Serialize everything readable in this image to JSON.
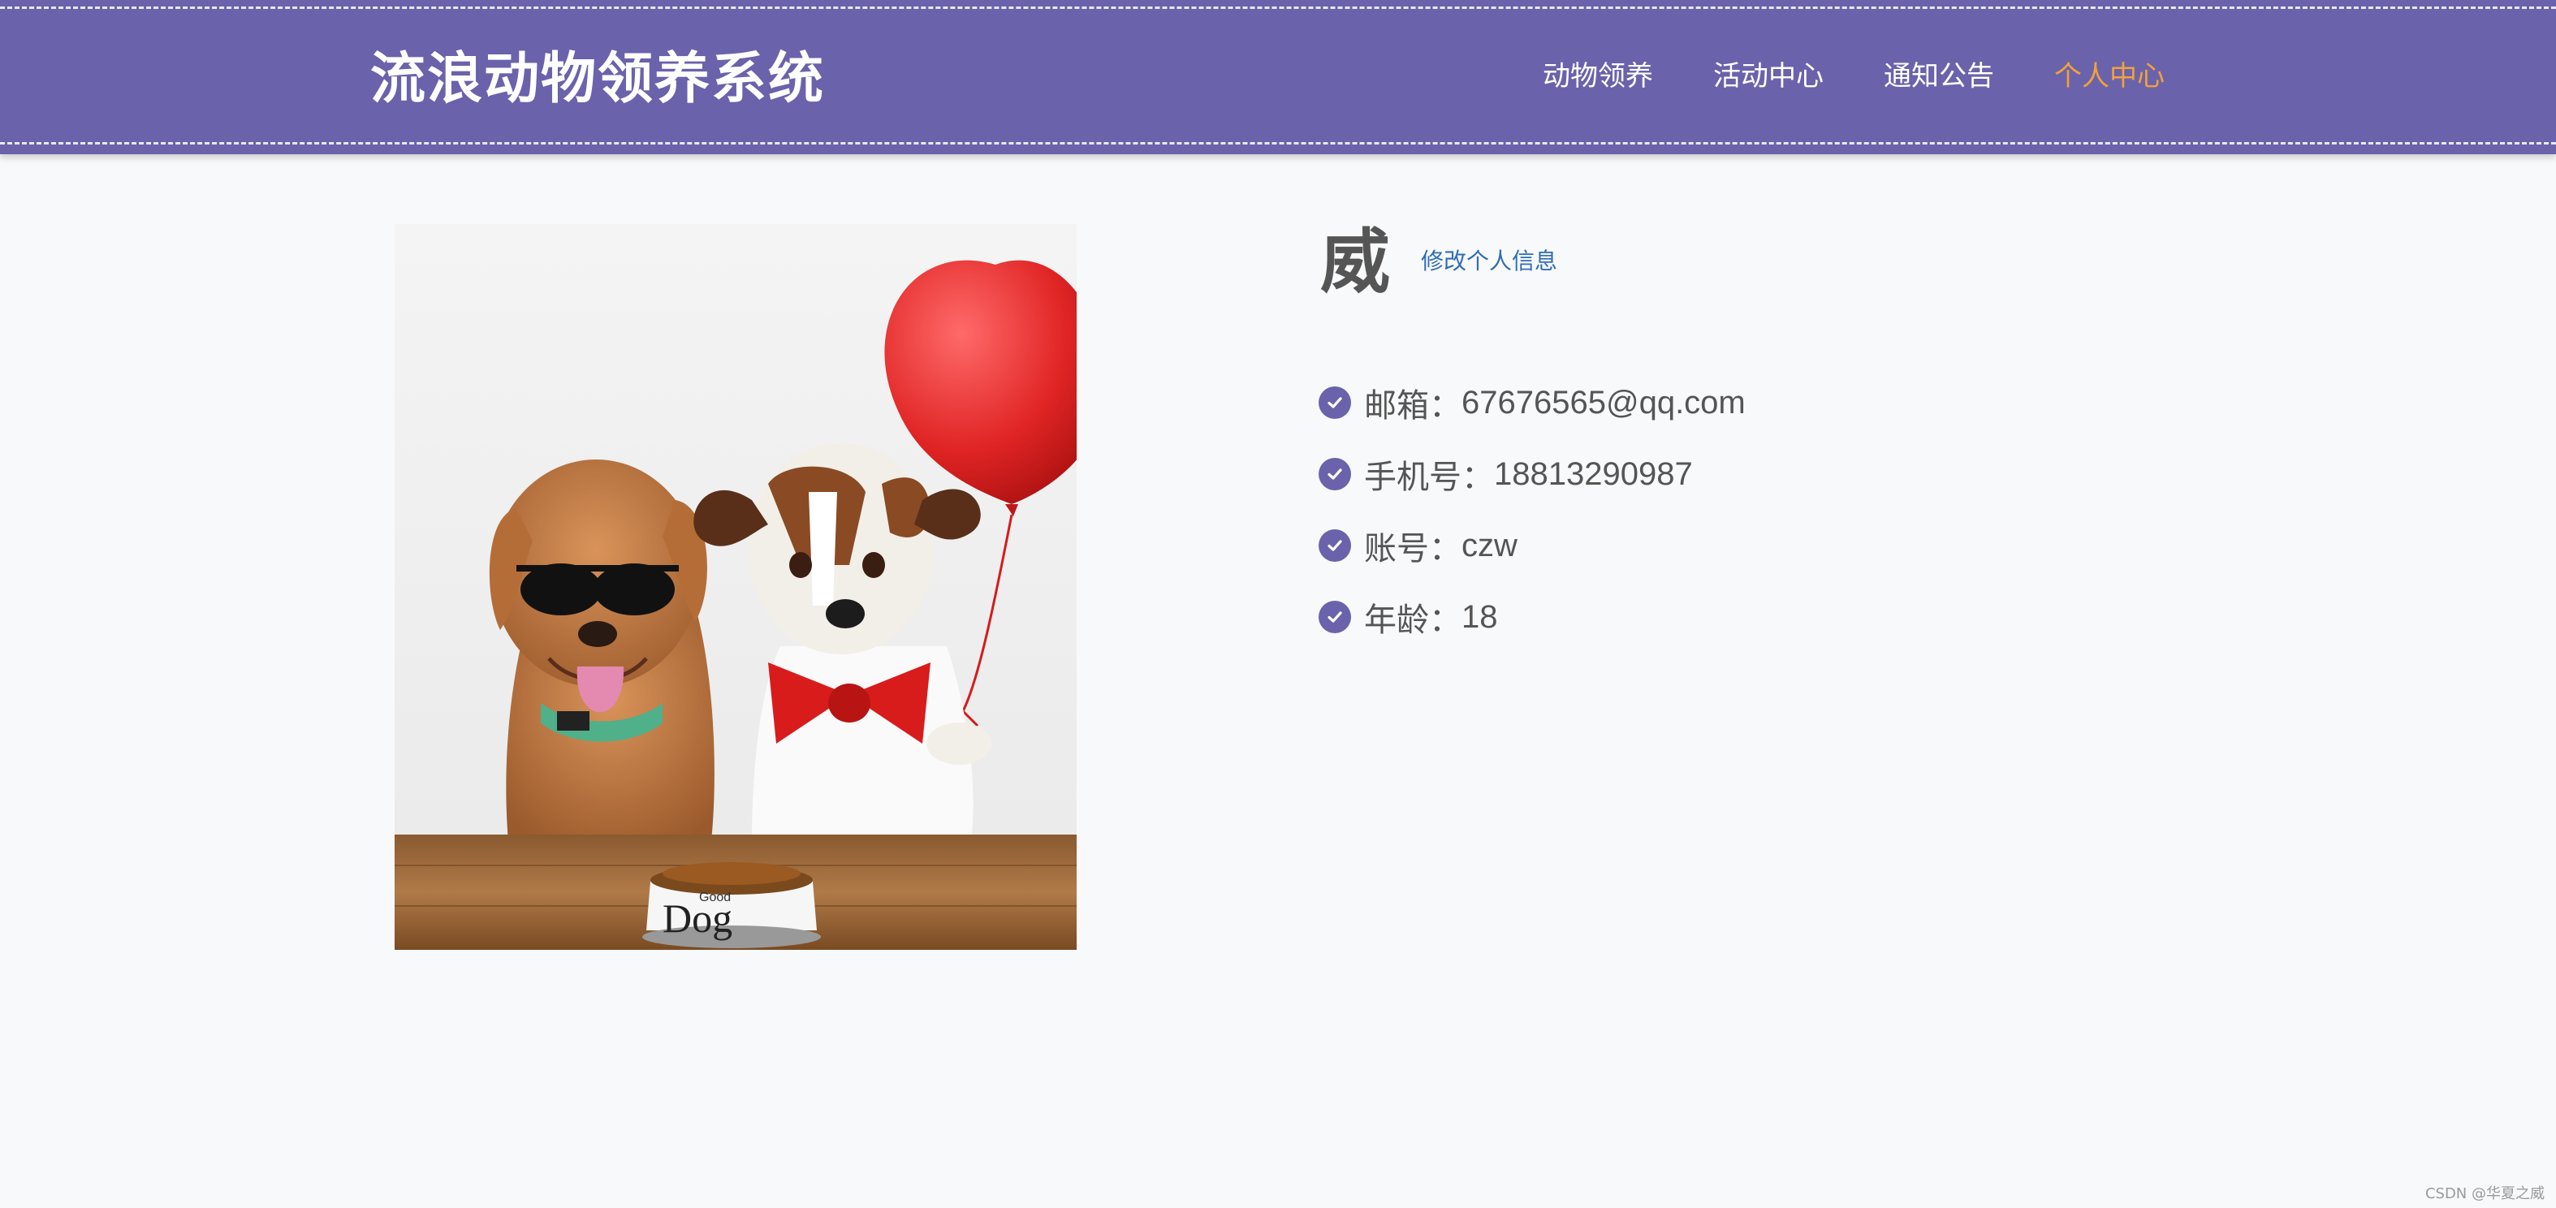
{
  "header": {
    "brand": "流浪动物领养系统",
    "nav": [
      {
        "label": "动物领养",
        "active": false
      },
      {
        "label": "活动中心",
        "active": false
      },
      {
        "label": "通知公告",
        "active": false
      },
      {
        "label": "个人中心",
        "active": true
      }
    ]
  },
  "profile": {
    "name": "威",
    "edit_label": "修改个人信息",
    "photo": {
      "bowl_label_small": "Good",
      "bowl_label": "Dog"
    },
    "info": [
      {
        "label": "邮箱：",
        "value": "67676565@qq.com"
      },
      {
        "label": "手机号：",
        "value": "18813290987"
      },
      {
        "label": "账号：",
        "value": "czw"
      },
      {
        "label": "年龄：",
        "value": "18"
      }
    ]
  },
  "watermark": "CSDN @华夏之威",
  "colors": {
    "header_bg": "#6b62ac",
    "active_nav": "#f0a23a",
    "link": "#2f6db5",
    "icon": "#6b62ac"
  }
}
